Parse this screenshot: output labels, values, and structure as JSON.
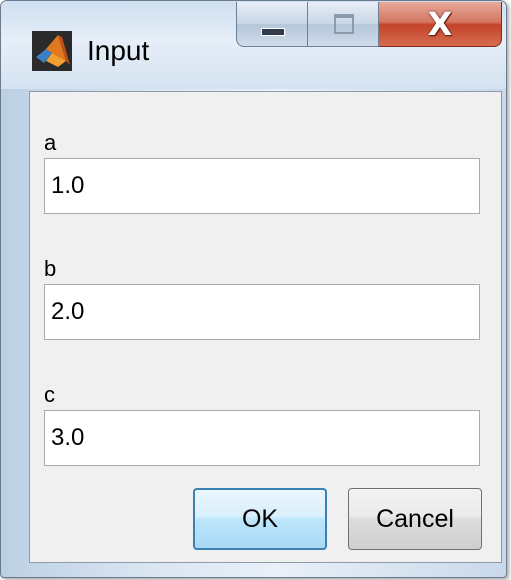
{
  "window": {
    "title": "Input",
    "icon": "matlab-logo-icon"
  },
  "titlebar_buttons": {
    "minimize": "minimize-icon",
    "maximize": "maximize-icon",
    "close_glyph": "X"
  },
  "fields": [
    {
      "label": "a",
      "value": "1.0"
    },
    {
      "label": "b",
      "value": "2.0"
    },
    {
      "label": "c",
      "value": "3.0"
    }
  ],
  "buttons": {
    "ok": "OK",
    "cancel": "Cancel"
  },
  "colors": {
    "close_button": "#c2432a",
    "ok_button_border": "#3c7fb1",
    "client_background": "#f0f0f0"
  }
}
